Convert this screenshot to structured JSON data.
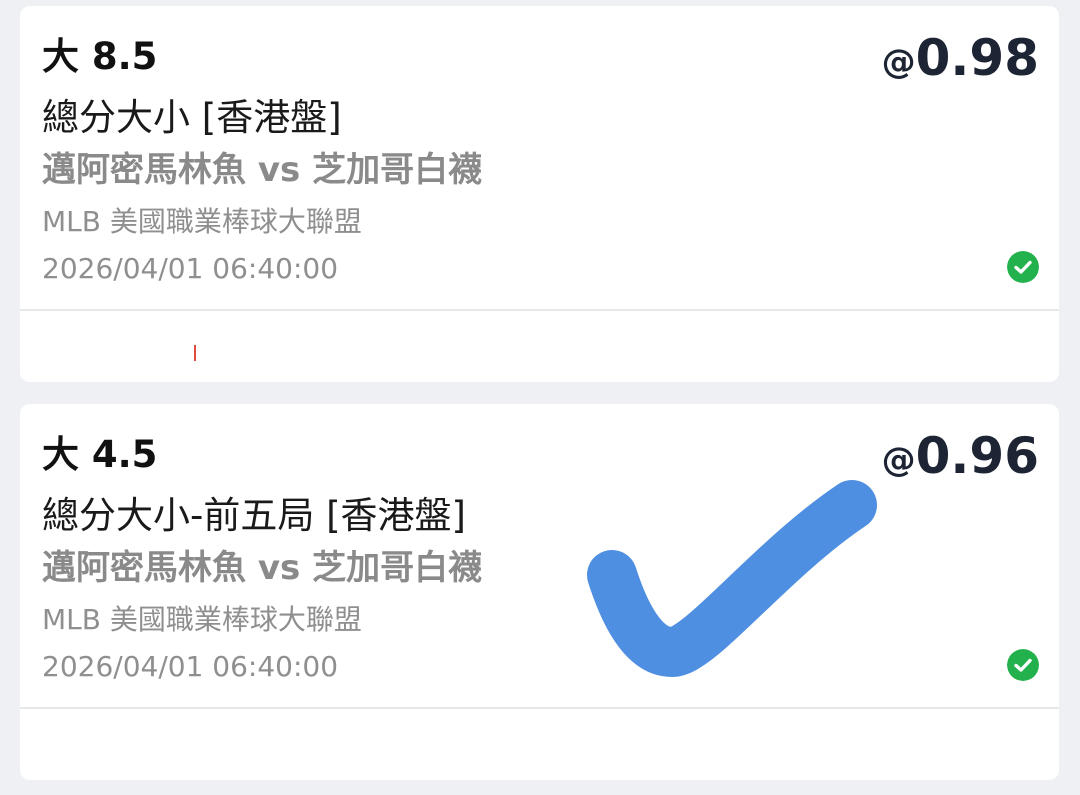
{
  "colors": {
    "page_background": "#eef0f4",
    "card_background": "#ffffff",
    "odds_text": "#1d2433",
    "status_green": "#22b14c",
    "overlay_check": "#4f8fe2"
  },
  "bets": [
    {
      "selection": "大 8.5",
      "odds_prefix": "@",
      "odds_value": "0.98",
      "market": "總分大小 [香港盤]",
      "match": "邁阿密馬林魚 vs 芝加哥白襪",
      "league": "MLB 美國職業棒球大聯盟",
      "datetime": "2026/04/01 06:40:00",
      "status_icon": "check-circle-icon"
    },
    {
      "selection": "大 4.5",
      "odds_prefix": "@",
      "odds_value": "0.96",
      "market": "總分大小-前五局 [香港盤]",
      "match": "邁阿密馬林魚 vs 芝加哥白襪",
      "league": "MLB 美國職業棒球大聯盟",
      "datetime": "2026/04/01 06:40:00",
      "status_icon": "check-circle-icon"
    }
  ],
  "overlay": {
    "icon": "hand-drawn-checkmark-icon"
  }
}
